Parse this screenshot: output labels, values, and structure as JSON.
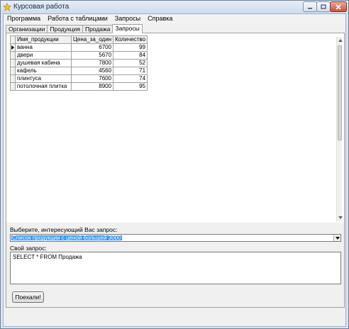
{
  "window": {
    "title": "Курсовая работа"
  },
  "menu": {
    "items": [
      "Программа",
      "Работа с таблицами",
      "Запросы",
      "Справка"
    ]
  },
  "tabs": [
    {
      "label": "Организации",
      "active": false
    },
    {
      "label": "Продукция",
      "active": false
    },
    {
      "label": "Продажа",
      "active": false
    },
    {
      "label": "Запросы",
      "active": true
    }
  ],
  "grid": {
    "columns": [
      "Имя_продукции",
      "Цена_за_один",
      "Количество"
    ],
    "rows": [
      {
        "name": "ванна",
        "price": "6700",
        "qty": "99",
        "current": true
      },
      {
        "name": "двери",
        "price": "5670",
        "qty": "84",
        "current": false
      },
      {
        "name": "душевая кабина",
        "price": "7800",
        "qty": "52",
        "current": false
      },
      {
        "name": "кафель",
        "price": "4560",
        "qty": "71",
        "current": false
      },
      {
        "name": "плинтуса",
        "price": "7600",
        "qty": "74",
        "current": false
      },
      {
        "name": "потолочная плитка",
        "price": "8900",
        "qty": "95",
        "current": false
      }
    ]
  },
  "query_panel": {
    "select_label": "Выберите, интересующий Вас запрос:",
    "selected_query": "Список продукции с ценой большей 3000",
    "own_query_label": "Свой запрос:",
    "own_query_text": "SELECT * FROM Продажа",
    "run_button": "Поехали!"
  },
  "colors": {
    "selection": "#3399ff",
    "window_frame": "#d9e4f1",
    "close_button": "#c8523b"
  }
}
